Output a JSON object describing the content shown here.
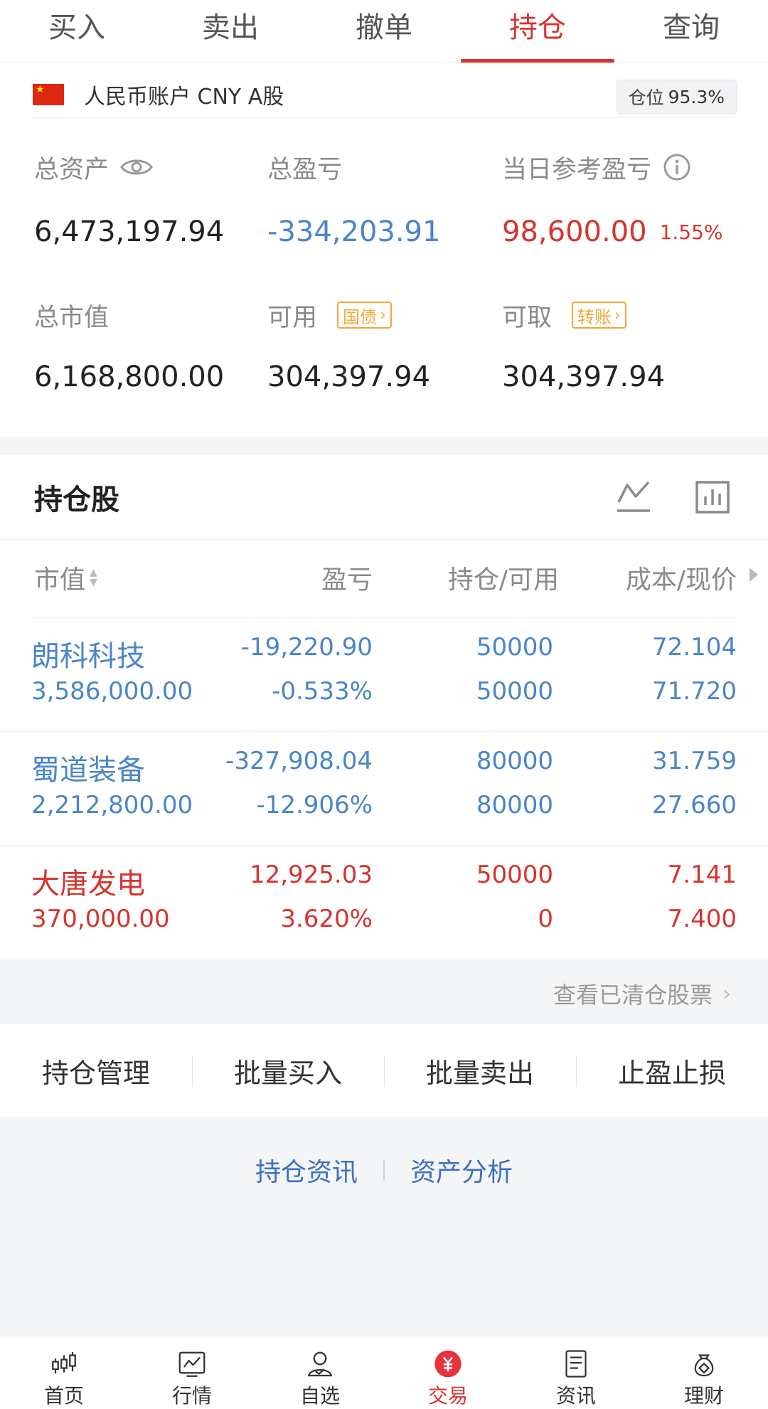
{
  "top_tabs": [
    {
      "label": "买入"
    },
    {
      "label": "卖出"
    },
    {
      "label": "撤单"
    },
    {
      "label": "持仓"
    },
    {
      "label": "查询"
    }
  ],
  "account": {
    "label": "人民币账户 CNY A股",
    "position_label": "仓位",
    "position_value": "95.3%"
  },
  "assets": {
    "total_assets_label": "总资产",
    "total_assets": "6,473,197.94",
    "total_pl_label": "总盈亏",
    "total_pl": "-334,203.91",
    "daily_pl_label": "当日参考盈亏",
    "daily_pl": "98,600.00",
    "daily_pl_pct": "1.55%",
    "market_value_label": "总市值",
    "market_value": "6,168,800.00",
    "available_label": "可用",
    "available_tag": "国债",
    "available": "304,397.94",
    "withdrawable_label": "可取",
    "withdrawable_tag": "转账",
    "withdrawable": "304,397.94"
  },
  "holdings": {
    "title": "持仓股",
    "columns": [
      "市值",
      "盈亏",
      "持仓/可用",
      "成本/现价"
    ],
    "rows": [
      {
        "name": "朗科科技",
        "market_value": "3,586,000.00",
        "pl": "-19,220.90",
        "pl_pct": "-0.533%",
        "position": "50000",
        "available": "50000",
        "cost": "72.104",
        "price": "71.720"
      },
      {
        "name": "蜀道装备",
        "market_value": "2,212,800.00",
        "pl": "-327,908.04",
        "pl_pct": "-12.906%",
        "position": "80000",
        "available": "80000",
        "cost": "31.759",
        "price": "27.660"
      },
      {
        "name": "大唐发电",
        "market_value": "370,000.00",
        "pl": "12,925.03",
        "pl_pct": "3.620%",
        "position": "50000",
        "available": "0",
        "cost": "7.141",
        "price": "7.400"
      }
    ],
    "cleared_link": "查看已清仓股票"
  },
  "actions": [
    "持仓管理",
    "批量买入",
    "批量卖出",
    "止盈止损"
  ],
  "links": [
    "持仓资讯",
    "资产分析"
  ],
  "bottom_nav": [
    {
      "label": "首页",
      "icon": "candlestick-icon"
    },
    {
      "label": "行情",
      "icon": "chart-monitor-icon"
    },
    {
      "label": "自选",
      "icon": "user-check-icon"
    },
    {
      "label": "交易",
      "icon": "yuan-icon"
    },
    {
      "label": "资讯",
      "icon": "document-icon"
    },
    {
      "label": "理财",
      "icon": "money-bag-icon"
    }
  ],
  "colors": {
    "accent": "#d8332f",
    "loss": "#4a85c7",
    "gain": "#d8332f",
    "tag": "#f2a735"
  }
}
